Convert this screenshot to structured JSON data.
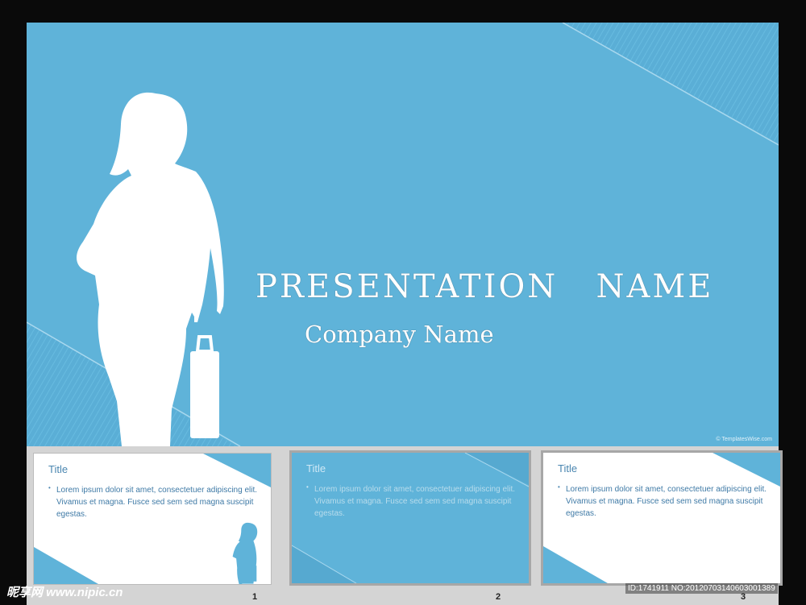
{
  "slide": {
    "title": "PRESENTATION   NAME",
    "subtitle": "Company Name",
    "credit": "© TemplatesWise.com"
  },
  "thumbnails": [
    {
      "title": "Title",
      "body": "Lorem ipsum dolor sit amet, consectetuer adipiscing elit. Vivamus et magna. Fusce sed sem sed magna suscipit egestas.",
      "number": "1",
      "state": "normal"
    },
    {
      "title": "Title",
      "body": "Lorem ipsum dolor sit amet, consectetuer adipiscing elit. Vivamus et magna. Fusce sed sem sed magna suscipit egestas.",
      "number": "2",
      "state": "blue"
    },
    {
      "title": "Title",
      "body": "Lorem ipsum dolor sit amet, consectetuer adipiscing elit. Vivamus et magna. Fusce sed sem sed magna suscipit egestas.",
      "number": "3",
      "state": "normal"
    }
  ],
  "footer": {
    "site": "昵享网 www.nipic.cn",
    "id_text": "ID:1741911 NO:20120703140603001389"
  },
  "colors": {
    "slide_bg": "#5fb3d9",
    "frame": "#0a0a0a",
    "strip": "#d4d4d4"
  },
  "icons": [
    "businesswoman-silhouette-icon",
    "bullet-icon"
  ]
}
